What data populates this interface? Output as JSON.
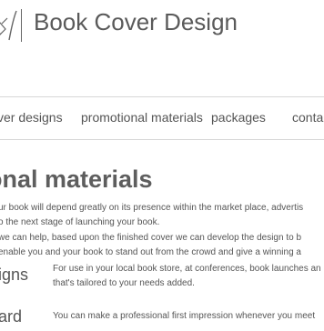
{
  "header": {
    "site_title": "Book Cover Design"
  },
  "nav": {
    "items": [
      {
        "label": "ver designs"
      },
      {
        "label": "promotional materials"
      },
      {
        "label": "packages"
      },
      {
        "label": "conta"
      }
    ]
  },
  "main": {
    "section_heading": "onal materials",
    "intro_lines": [
      "ur book will depend greatly on its presence within the market place, advertis",
      "o the next stage of launching your book.",
      "we can help, based upon the finished cover we can develop the design to b",
      "enable you and your book to stand out from the crowd and give a winning a"
    ],
    "rows": [
      {
        "label": "igns",
        "lines": [
          "For use in your local book store, at conferences, book launches an",
          "that's tailored to your needs added."
        ]
      },
      {
        "label": "ard",
        "lines": [
          "You can make a professional first impression whenever you meet"
        ]
      }
    ]
  }
}
